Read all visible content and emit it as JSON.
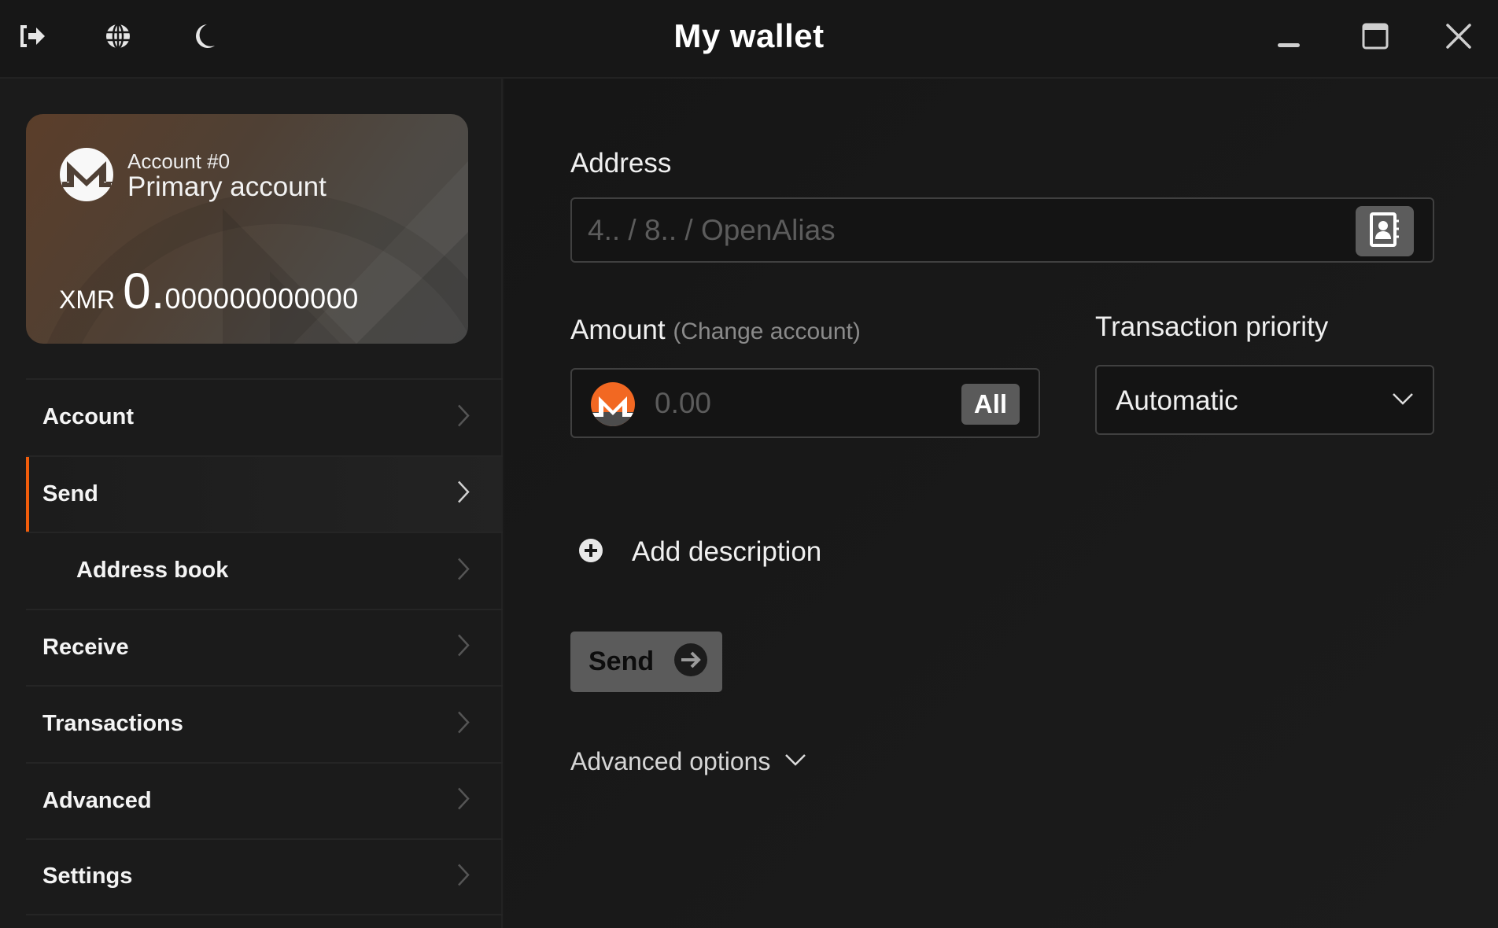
{
  "titlebar": {
    "title": "My wallet",
    "left_icons": [
      "logout-icon",
      "globe-icon",
      "moon-icon"
    ],
    "window_controls": [
      "minimize-icon",
      "maximize-icon",
      "close-icon"
    ]
  },
  "account_card": {
    "account_number": "Account #0",
    "account_name": "Primary account",
    "currency": "XMR",
    "balance_integer": "0.",
    "balance_fraction": "000000000000"
  },
  "sidebar": {
    "items": [
      {
        "label": "Account",
        "active": false,
        "sub": false
      },
      {
        "label": "Send",
        "active": true,
        "sub": false
      },
      {
        "label": "Address book",
        "active": false,
        "sub": true
      },
      {
        "label": "Receive",
        "active": false,
        "sub": false
      },
      {
        "label": "Transactions",
        "active": false,
        "sub": false
      },
      {
        "label": "Advanced",
        "active": false,
        "sub": false
      },
      {
        "label": "Settings",
        "active": false,
        "sub": false
      }
    ]
  },
  "send_form": {
    "address_label": "Address",
    "address_placeholder": "4.. / 8.. / OpenAlias",
    "address_value": "",
    "amount_label": "Amount",
    "change_account_link": "(Change account)",
    "amount_placeholder": "0.00",
    "amount_value": "",
    "all_button": "All",
    "priority_label": "Transaction priority",
    "priority_selected": "Automatic",
    "add_description": "Add description",
    "send_button": "Send",
    "advanced_options": "Advanced options"
  },
  "colors": {
    "accent": "#f15d0b",
    "background": "#1a1a1a",
    "titlebar": "#171717"
  }
}
